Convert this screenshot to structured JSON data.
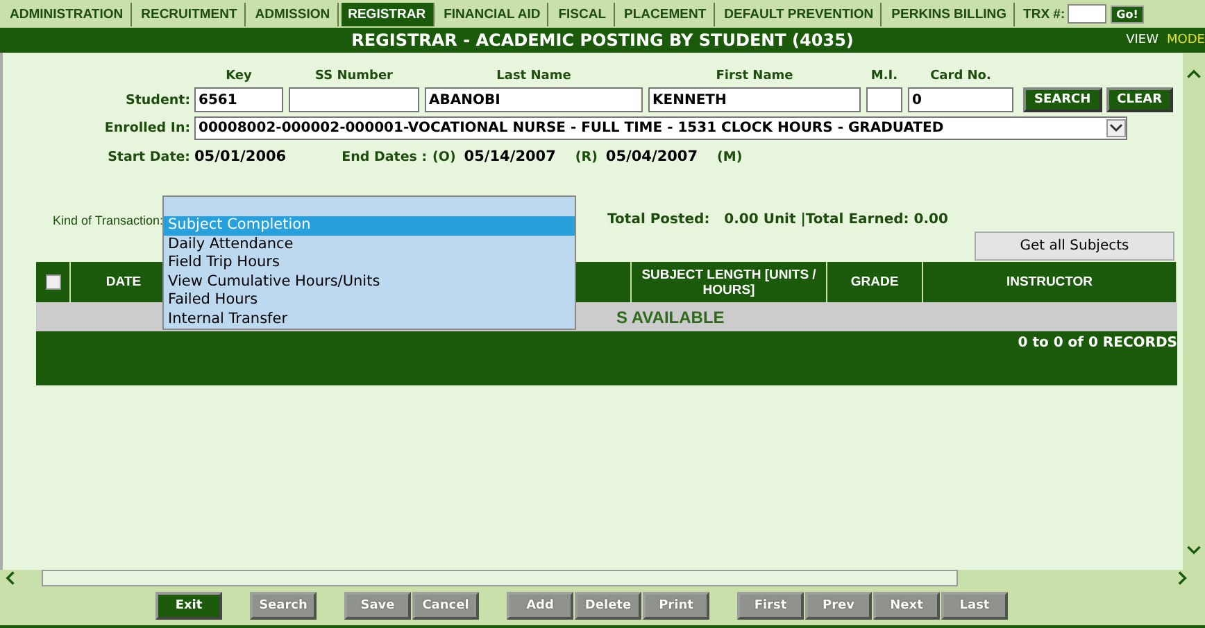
{
  "nav_tabs": [
    {
      "label": "ADMINISTRATION",
      "selected": false
    },
    {
      "label": "RECRUITMENT",
      "selected": false
    },
    {
      "label": "ADMISSION",
      "selected": false
    },
    {
      "label": "REGISTRAR",
      "selected": true
    },
    {
      "label": "FINANCIAL AID",
      "selected": false
    },
    {
      "label": "FISCAL",
      "selected": false
    },
    {
      "label": "PLACEMENT",
      "selected": false
    },
    {
      "label": "DEFAULT PREVENTION",
      "selected": false
    },
    {
      "label": "PERKINS BILLING",
      "selected": false
    }
  ],
  "trx": {
    "label": "TRX #:",
    "button": "Go!"
  },
  "title": "REGISTRAR - ACADEMIC POSTING BY STUDENT (4035)",
  "view_links": [
    {
      "label": "VIEW",
      "selected": false
    },
    {
      "label": "MODE",
      "selected": true
    }
  ],
  "student": {
    "label": "Student:",
    "fields": [
      {
        "heading": "Key",
        "value": "6561"
      },
      {
        "heading": "SS Number"
      },
      {
        "heading": "Last Name",
        "value": "ABANOBI"
      },
      {
        "heading": "First Name",
        "value": "KENNETH"
      },
      {
        "heading": "M.I."
      },
      {
        "heading": "Card No.",
        "value": "0"
      }
    ],
    "buttons": [
      "SEARCH",
      "CLEAR"
    ]
  },
  "enrolled": {
    "label": "Enrolled In:",
    "value": "00008002-000002-000001-VOCATIONAL NURSE - FULL TIME - 1531 CLOCK HOURS - GRADUATED"
  },
  "dates": {
    "start_label": "Start Date:",
    "start": "05/01/2006",
    "end_label": "End Dates :",
    "o_tag": "(O)",
    "o_date": "05/14/2007",
    "r_tag": "(R)",
    "r_date": "05/04/2007",
    "m_tag": "(M)"
  },
  "transaction": {
    "label": "Kind of Transaction:",
    "options": [
      {
        "label": "Subject Completion",
        "selected": true
      },
      {
        "label": "Daily Attendance",
        "selected": false
      },
      {
        "label": "Field Trip Hours",
        "selected": false
      },
      {
        "label": "View Cumulative Hours/Units",
        "selected": false
      },
      {
        "label": "Failed Hours",
        "selected": false
      },
      {
        "label": "Internal Transfer",
        "selected": false
      }
    ]
  },
  "totals": "Total Posted:   0.00 Unit |Total Earned: 0.00",
  "get_all_button": "Get all Subjects",
  "table": {
    "select_all_checked": false,
    "columns": [
      "DATE",
      "",
      "SUBJECT LENGTH [UNITS / HOURS]",
      "GRADE",
      "INSTRUCTOR"
    ],
    "empty_message": "S AVAILABLE",
    "records": "0 to 0 of 0 RECORDS"
  },
  "footer_button_groups": [
    [
      {
        "label": "Exit",
        "disabled": false
      }
    ],
    [
      {
        "label": "Search",
        "disabled": true
      }
    ],
    [
      {
        "label": "Save",
        "disabled": true
      },
      {
        "label": "Cancel",
        "disabled": true
      }
    ],
    [
      {
        "label": "Add",
        "disabled": true
      },
      {
        "label": "Delete",
        "disabled": true
      },
      {
        "label": "Print",
        "disabled": true
      }
    ],
    [
      {
        "label": "First",
        "disabled": true
      },
      {
        "label": "Prev",
        "disabled": true
      },
      {
        "label": "Next",
        "disabled": true
      },
      {
        "label": "Last",
        "disabled": true
      }
    ]
  ]
}
